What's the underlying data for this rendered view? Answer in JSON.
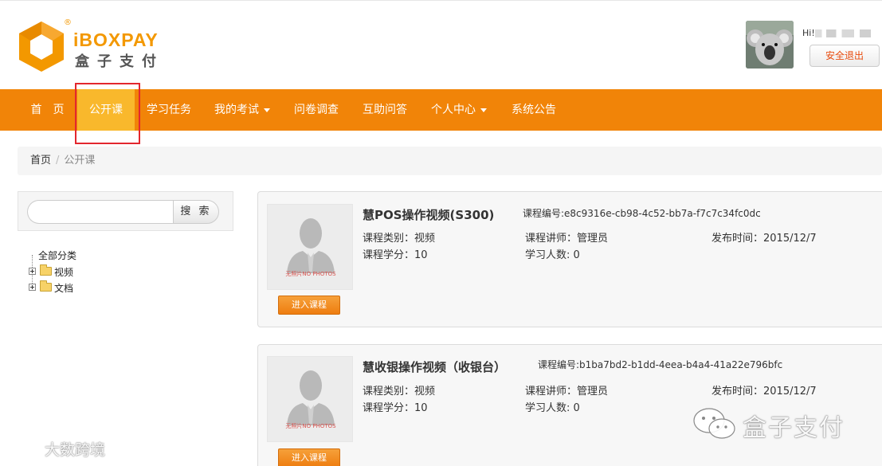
{
  "brand": {
    "name_en": "iBOXPAY",
    "name_cn": "盒子支付",
    "reg_mark": "®",
    "accent_color": "#f18408"
  },
  "user": {
    "greeting": "Hi!",
    "logout_label": "安全退出"
  },
  "nav": {
    "items": [
      {
        "label": "首　页",
        "has_dropdown": false,
        "active": false
      },
      {
        "label": "公开课",
        "has_dropdown": false,
        "active": true
      },
      {
        "label": "学习任务",
        "has_dropdown": false,
        "active": false
      },
      {
        "label": "我的考试",
        "has_dropdown": true,
        "active": false
      },
      {
        "label": "问卷调查",
        "has_dropdown": false,
        "active": false
      },
      {
        "label": "互助问答",
        "has_dropdown": false,
        "active": false
      },
      {
        "label": "个人中心",
        "has_dropdown": true,
        "active": false
      },
      {
        "label": "系统公告",
        "has_dropdown": false,
        "active": false
      }
    ]
  },
  "breadcrumb": {
    "home": "首页",
    "separator": "/",
    "current": "公开课"
  },
  "sidebar": {
    "search": {
      "value": "",
      "button_label": "搜 索"
    },
    "tree": {
      "root": "全部分类",
      "nodes": [
        {
          "label": "视频"
        },
        {
          "label": "文档"
        }
      ]
    }
  },
  "courses": [
    {
      "title": "慧POS操作视频(S300)",
      "code": "课程编号:e8c9316e-cb98-4c52-bb7a-f7c7c34fc0dc",
      "category": "课程类别：视频",
      "lecturer": "课程讲师：管理员",
      "publish_time": "发布时间：2015/12/7",
      "credits": "课程学分：10",
      "learners": "学习人数: 0",
      "thumb_caption": "无照片NO PHOTOS",
      "enter_label": "进入课程"
    },
    {
      "title": "慧收银操作视频（收银台）",
      "code": "课程编号:b1ba7bd2-b1dd-4eea-b4a4-41a22e796bfc",
      "category": "课程类别：视频",
      "lecturer": "课程讲师：管理员",
      "publish_time": "发布时间：2015/12/7",
      "credits": "课程学分：10",
      "learners": "学习人数: 0",
      "thumb_caption": "无照片NO PHOTOS",
      "enter_label": "进入课程"
    }
  ],
  "watermarks": {
    "left": "大数跨境",
    "right": "盒子支付"
  }
}
